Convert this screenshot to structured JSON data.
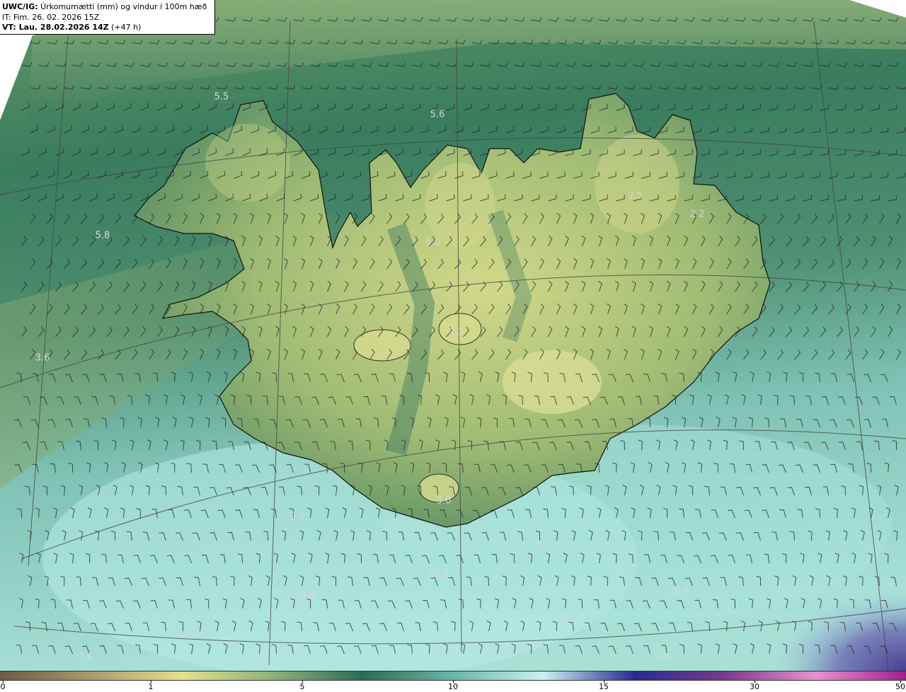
{
  "header": {
    "product_code": "UWC/IG:",
    "title": " Úrkomumætti (mm) og vindur í 100m hæð",
    "init_time": "IT: Fim. 26. 02. 2026 15Z",
    "valid_prefix": "VT: Lau. 28.02.2026 14Z",
    "valid_suffix": " (+47 h)"
  },
  "colorbar": {
    "ticks": [
      "0",
      "1",
      "5",
      "10",
      "15",
      "30",
      "50"
    ],
    "stops": [
      "#6b5a45",
      "#a99a6c",
      "#e3de8c",
      "#8fb27a",
      "#2d6b55",
      "#6cb5a5",
      "#c8f0f0",
      "#2a2a90",
      "#7a3a8a",
      "#e890d0",
      "#a0208a"
    ]
  },
  "value_labels": [
    {
      "text": "5.5"
    },
    {
      "text": "5.6"
    },
    {
      "text": "5.8"
    },
    {
      "text": "6.0"
    },
    {
      "text": "2.5"
    },
    {
      "text": "2.2"
    },
    {
      "text": "2.1"
    },
    {
      "text": "3.6"
    },
    {
      "text": "3.0"
    },
    {
      "text": "9.9"
    },
    {
      "text": "9.3"
    },
    {
      "text": "10.2"
    },
    {
      "text": "10.3"
    },
    {
      "text": "10.4"
    },
    {
      "text": "9.9"
    },
    {
      "text": "7.2"
    },
    {
      "text": "7.6"
    },
    {
      "text": "9.0"
    }
  ],
  "colors": {
    "land_light": "#d8dc8c",
    "land_mid": "#7fa56a",
    "sea_dark": "#2f6e58",
    "sea_light": "#9ed6cc",
    "coastline": "#1a1a1a",
    "grid": "#444444"
  }
}
